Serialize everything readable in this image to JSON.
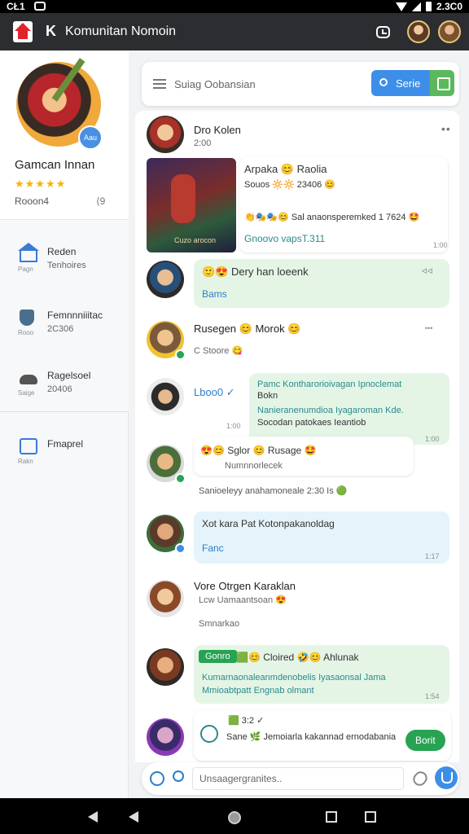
{
  "status_bar": {
    "time": "CŁ1",
    "battery_text": "2.3C0"
  },
  "app_bar": {
    "title": "Komunitan Nomoin",
    "k_mark": "K",
    "logo_icon": "app-logo-icon",
    "clock_icon": "clock-icon"
  },
  "sidebar": {
    "profile": {
      "name": "Gamcan Innan",
      "rating": "★★★★★",
      "stat_left": "Rooon4",
      "stat_right": "⟨9",
      "badge": "Aau"
    },
    "items": [
      {
        "label": "Reden",
        "sub": "Tenhoires",
        "caption": "Pagn",
        "icon": "house-icon"
      },
      {
        "label": "Femnnniiitac",
        "sub": "2C306",
        "caption": "Rooo",
        "icon": "shield-icon"
      },
      {
        "label": "Ragelsoel",
        "sub": "20406",
        "caption": "Saige",
        "icon": "car-icon"
      },
      {
        "label": "Fmaprel",
        "sub": "",
        "caption": "Rakn",
        "icon": "gift-icon"
      }
    ]
  },
  "search": {
    "placeholder": "Suiag Oobansian",
    "button_label": "Serie"
  },
  "feed": {
    "post": {
      "author": "Dro Kolen",
      "time": "2:00",
      "card_title": "Arpaka 😊 Raolia",
      "card_line": "Souos 🔆🔆 2​3406 😊",
      "card_desc": "👏🎭🎭😊 Sal anaonsperemked 1 7​6​24 🤩",
      "card_link": "Gnoovo vapsT.311",
      "card_stamp": "1:00",
      "image_caption": "Cuzo arocon"
    },
    "messages": [
      {
        "name": "🙂😍 Dery han loeenk",
        "sub": "Bams",
        "stamp": "ᐊᐊ"
      },
      {
        "name": "Rusegen 😊 Morok 😊",
        "sub": "C Stoore 😋",
        "stamp": "•••"
      },
      {
        "name": "Lboo0 ✓",
        "line1": "Pamc Kontharorioivagan Ipnoclemat",
        "line2": "Bokn",
        "line3": "Nanieranenumdioa Iyagaroman Kde.",
        "line4": "Socodan patokaes Ieantiob",
        "stamp_left": "1:00",
        "stamp": "1:00"
      },
      {
        "name": "😍😊 Sglor 😊 Rusage 🤩",
        "sub": "Numnnorlecek",
        "extra": "Sanioeleyy anahamoneale 2:30 Is 🟢"
      },
      {
        "name": "Xot kara Pat Kotonpakanoldag",
        "sub": "Fanc",
        "stamp": "1:17"
      },
      {
        "name": "Vore Otrgen Karaklan",
        "sub": "Lcw  Uamaantsoan 😍",
        "extra": "Smnarkao"
      },
      {
        "chip": "Gonro",
        "name": "🟩😊 Cloired 🤣😊 Ahlunak",
        "line1": "Kumarnaonaleanmdenobelis Iyasaonsal Jama",
        "line2": "Mmioabtpatt Engnab olmant",
        "stamp": "1:54"
      },
      {
        "name": "🟩 3:2 ✓",
        "line1": "Sane 🌿 Jemoiarla kakannad ernodabania",
        "button": "Borit"
      }
    ]
  },
  "composer": {
    "placeholder": "Unsaagergranites.."
  }
}
